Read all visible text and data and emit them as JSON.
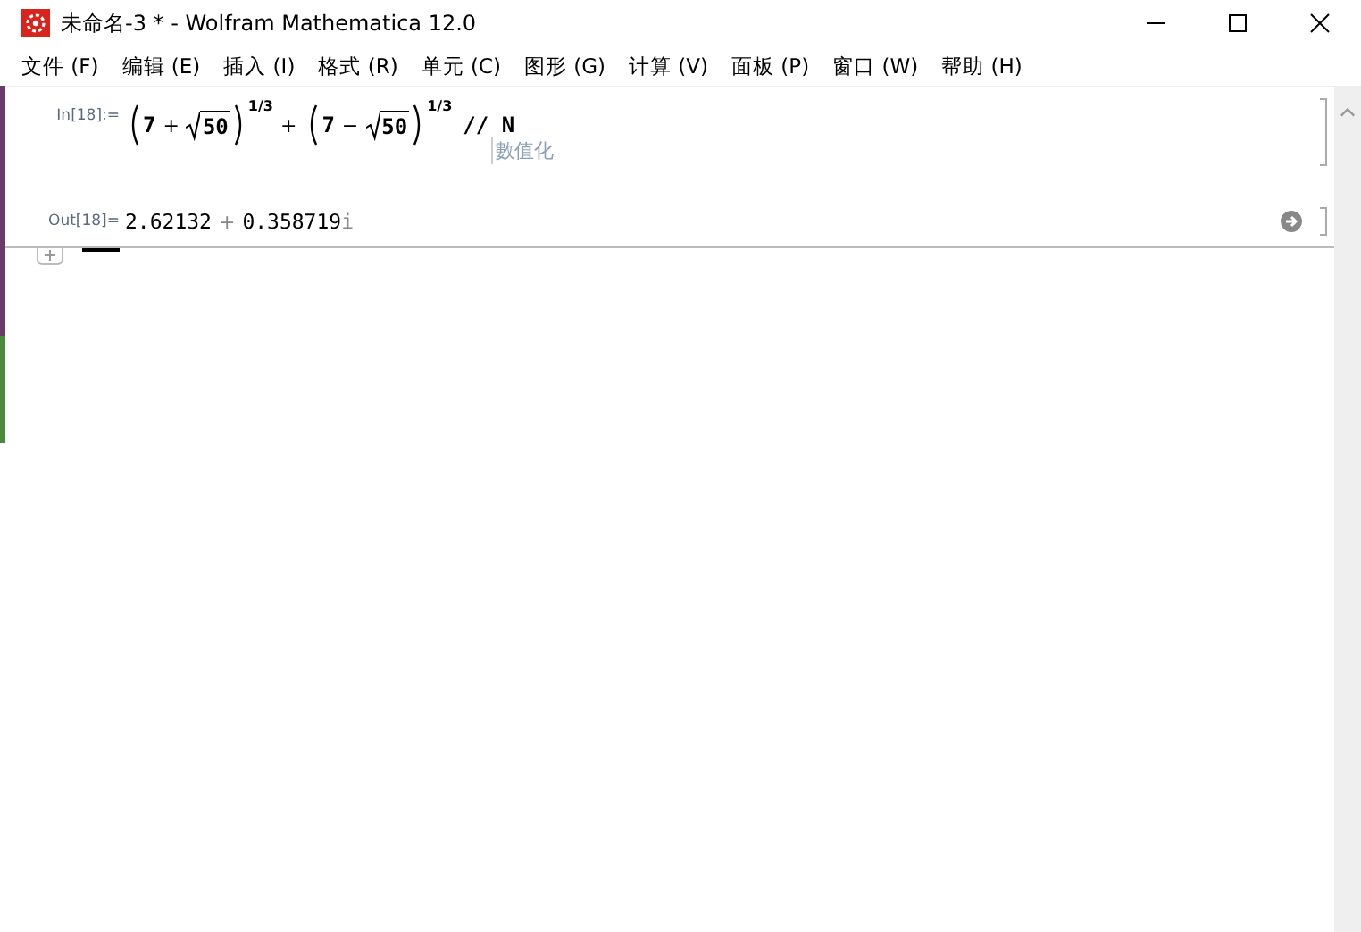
{
  "window": {
    "title": "未命名-3 * - Wolfram Mathematica 12.0"
  },
  "menu": [
    "文件 (F)",
    "编辑 (E)",
    "插入 (I)",
    "格式 (R)",
    "单元 (C)",
    "图形 (G)",
    "计算 (V)",
    "面板 (P)",
    "窗口 (W)",
    "帮助 (H)"
  ],
  "input": {
    "label": "In[18]:=",
    "terms": [
      {
        "base": "7",
        "op": "+",
        "radicand": "50",
        "exponent": "1/3"
      },
      {
        "base": "7",
        "op": "−",
        "radicand": "50",
        "exponent": "1/3"
      }
    ],
    "joiner": "+",
    "postfix": "// N",
    "suggestion": "數值化"
  },
  "output": {
    "label": "Out[18]=",
    "real": "2.62132",
    "op": "+",
    "imag": "0.358719",
    "unit": "i"
  }
}
